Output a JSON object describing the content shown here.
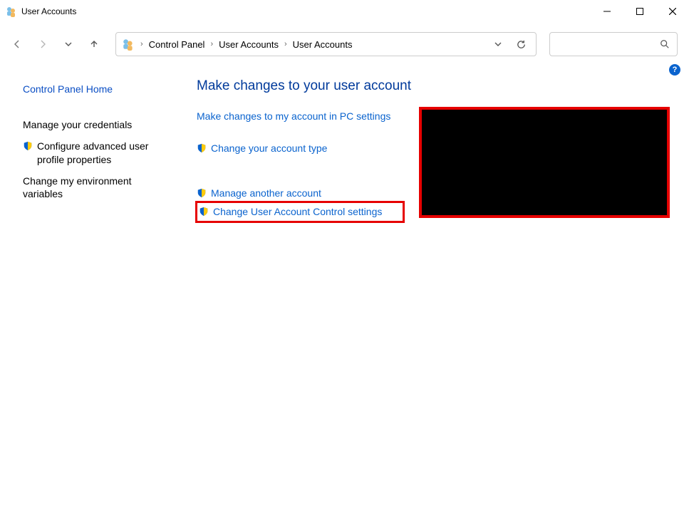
{
  "window": {
    "title": "User Accounts"
  },
  "breadcrumb": {
    "segments": [
      "Control Panel",
      "User Accounts",
      "User Accounts"
    ]
  },
  "sidebar": {
    "home": "Control Panel Home",
    "items": [
      {
        "label": "Manage your credentials",
        "shield": false
      },
      {
        "label": "Configure advanced user profile properties",
        "shield": true
      },
      {
        "label": "Change my environment variables",
        "shield": false
      }
    ]
  },
  "main": {
    "heading": "Make changes to your user account",
    "actions_a": [
      {
        "label": "Make changes to my account in PC settings",
        "shield": false
      },
      {
        "label": "Change your account type",
        "shield": true
      }
    ],
    "actions_b": [
      {
        "label": "Manage another account",
        "shield": true
      },
      {
        "label": "Change User Account Control settings",
        "shield": true,
        "highlight": true
      }
    ]
  }
}
